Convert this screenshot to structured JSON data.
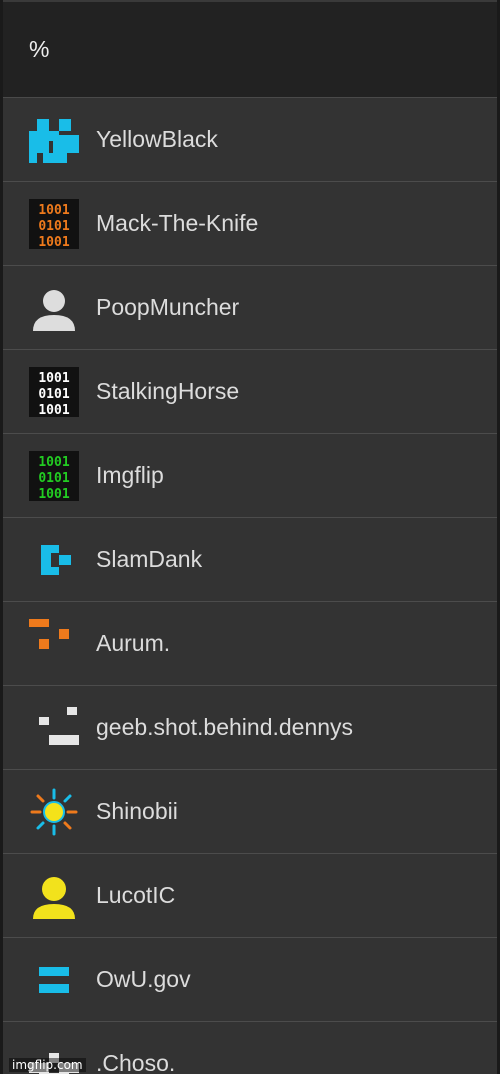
{
  "search": {
    "value": "%"
  },
  "users": [
    {
      "name": "YellowBlack",
      "icon": "cyan-blocky-identicon-icon",
      "color": "#19bde8"
    },
    {
      "name": "Mack-The-Knife",
      "icon": "orange-binary-identicon-icon",
      "color": "#ee7a1c"
    },
    {
      "name": "PoopMuncher",
      "icon": "default-user-silhouette-icon",
      "color": "#dddddd"
    },
    {
      "name": "StalkingHorse",
      "icon": "white-binary-identicon-icon",
      "color": "#ffffff"
    },
    {
      "name": "Imgflip",
      "icon": "green-binary-identicon-icon",
      "color": "#22cc22"
    },
    {
      "name": "SlamDank",
      "icon": "cyan-bracket-identicon-icon",
      "color": "#19bde8"
    },
    {
      "name": "Aurum.",
      "icon": "orange-pixel-identicon-icon",
      "color": "#ee7a1c"
    },
    {
      "name": "geeb.shot.behind.dennys",
      "icon": "white-face-identicon-icon",
      "color": "#e6e6e6"
    },
    {
      "name": "Shinobii",
      "icon": "sun-burst-icon",
      "color": "#f4e21a"
    },
    {
      "name": "LucotIC",
      "icon": "yellow-user-silhouette-icon",
      "color": "#f2e21c"
    },
    {
      "name": "OwU.gov",
      "icon": "cyan-equals-identicon-icon",
      "color": "#19bde8"
    },
    {
      "name": ".Choso.",
      "icon": "white-checker-identicon-icon",
      "color": "#e6e6e6"
    }
  ],
  "watermark": "imgflip.com"
}
